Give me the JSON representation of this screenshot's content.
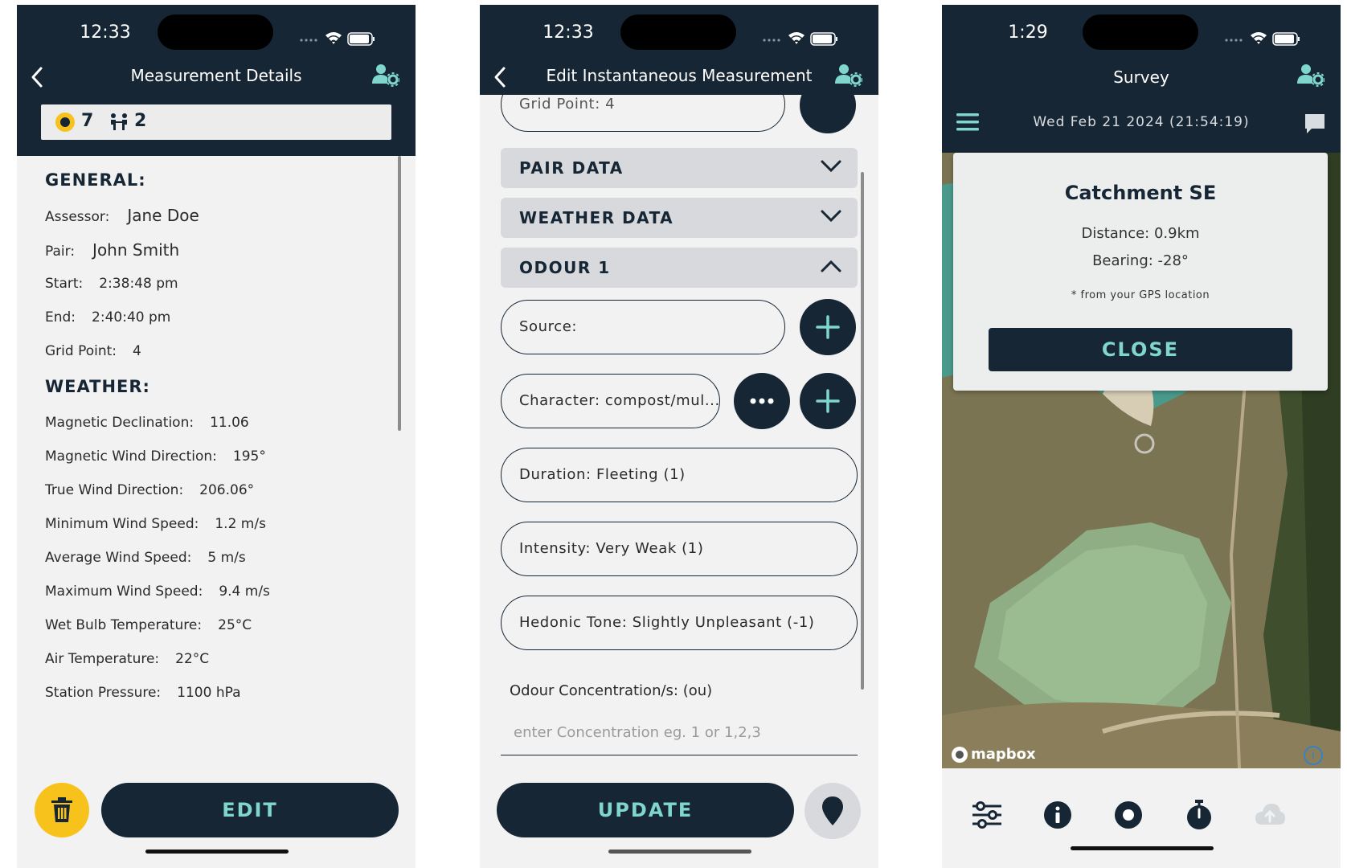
{
  "phone1": {
    "status": {
      "time": "12:33"
    },
    "header": {
      "title": "Measurement Details"
    },
    "counts": {
      "measurements": "7",
      "pairs": "2"
    },
    "general": {
      "heading": "GENERAL:",
      "rows": [
        {
          "label": "Assessor:",
          "value": "Jane Doe"
        },
        {
          "label": "Pair:",
          "value": "John Smith"
        },
        {
          "label": "Start:",
          "value": "2:38:48 pm"
        },
        {
          "label": "End:",
          "value": "2:40:40 pm"
        },
        {
          "label": "Grid Point:",
          "value": "4"
        }
      ]
    },
    "weather": {
      "heading": "WEATHER:",
      "rows": [
        {
          "label": "Magnetic Declination:",
          "value": "11.06"
        },
        {
          "label": "Magnetic Wind Direction:",
          "value": "195°"
        },
        {
          "label": "True Wind Direction:",
          "value": "206.06°"
        },
        {
          "label": "Minimum Wind Speed:",
          "value": "1.2 m/s"
        },
        {
          "label": "Average Wind Speed:",
          "value": "5 m/s"
        },
        {
          "label": "Maximum Wind Speed:",
          "value": "9.4 m/s"
        },
        {
          "label": "Wet Bulb Temperature:",
          "value": "25°C"
        },
        {
          "label": "Air Temperature:",
          "value": "22°C"
        },
        {
          "label": "Station Pressure:",
          "value": "1100 hPa"
        }
      ]
    },
    "edit_label": "EDIT"
  },
  "phone2": {
    "status": {
      "time": "12:33"
    },
    "header": {
      "title": "Edit Instantaneous Measurement"
    },
    "partial_field": "Grid Point: 4",
    "sections": {
      "pair": "PAIR DATA",
      "weather": "WEATHER DATA",
      "odour": "ODOUR 1"
    },
    "fields": {
      "source": "Source:",
      "character": "Character: compost/mul...",
      "duration": "Duration: Fleeting (1)",
      "intensity": "Intensity: Very Weak (1)",
      "hedonic": "Hedonic Tone: Slightly Unpleasant (-1)"
    },
    "concentration": {
      "label": "Odour Concentration/s: (ou)",
      "placeholder": "enter Concentration eg. 1 or 1,2,3"
    },
    "update_label": "UPDATE"
  },
  "phone3": {
    "status": {
      "time": "1:29"
    },
    "header": {
      "title": "Survey"
    },
    "date": "Wed Feb 21 2024 (21:54:19)",
    "card": {
      "title": "Catchment SE",
      "distance": "Distance: 0.9km",
      "bearing": "Bearing: -28°",
      "note": "* from your GPS location",
      "close_label": "CLOSE"
    },
    "map_attribution": "mapbox",
    "map_info": "i"
  },
  "colors": {
    "navy": "#172634",
    "teal": "#7fd6cc",
    "yellow": "#f6c21b",
    "light_bg": "#f2f2f2",
    "accordion": "#d7d9dc"
  }
}
